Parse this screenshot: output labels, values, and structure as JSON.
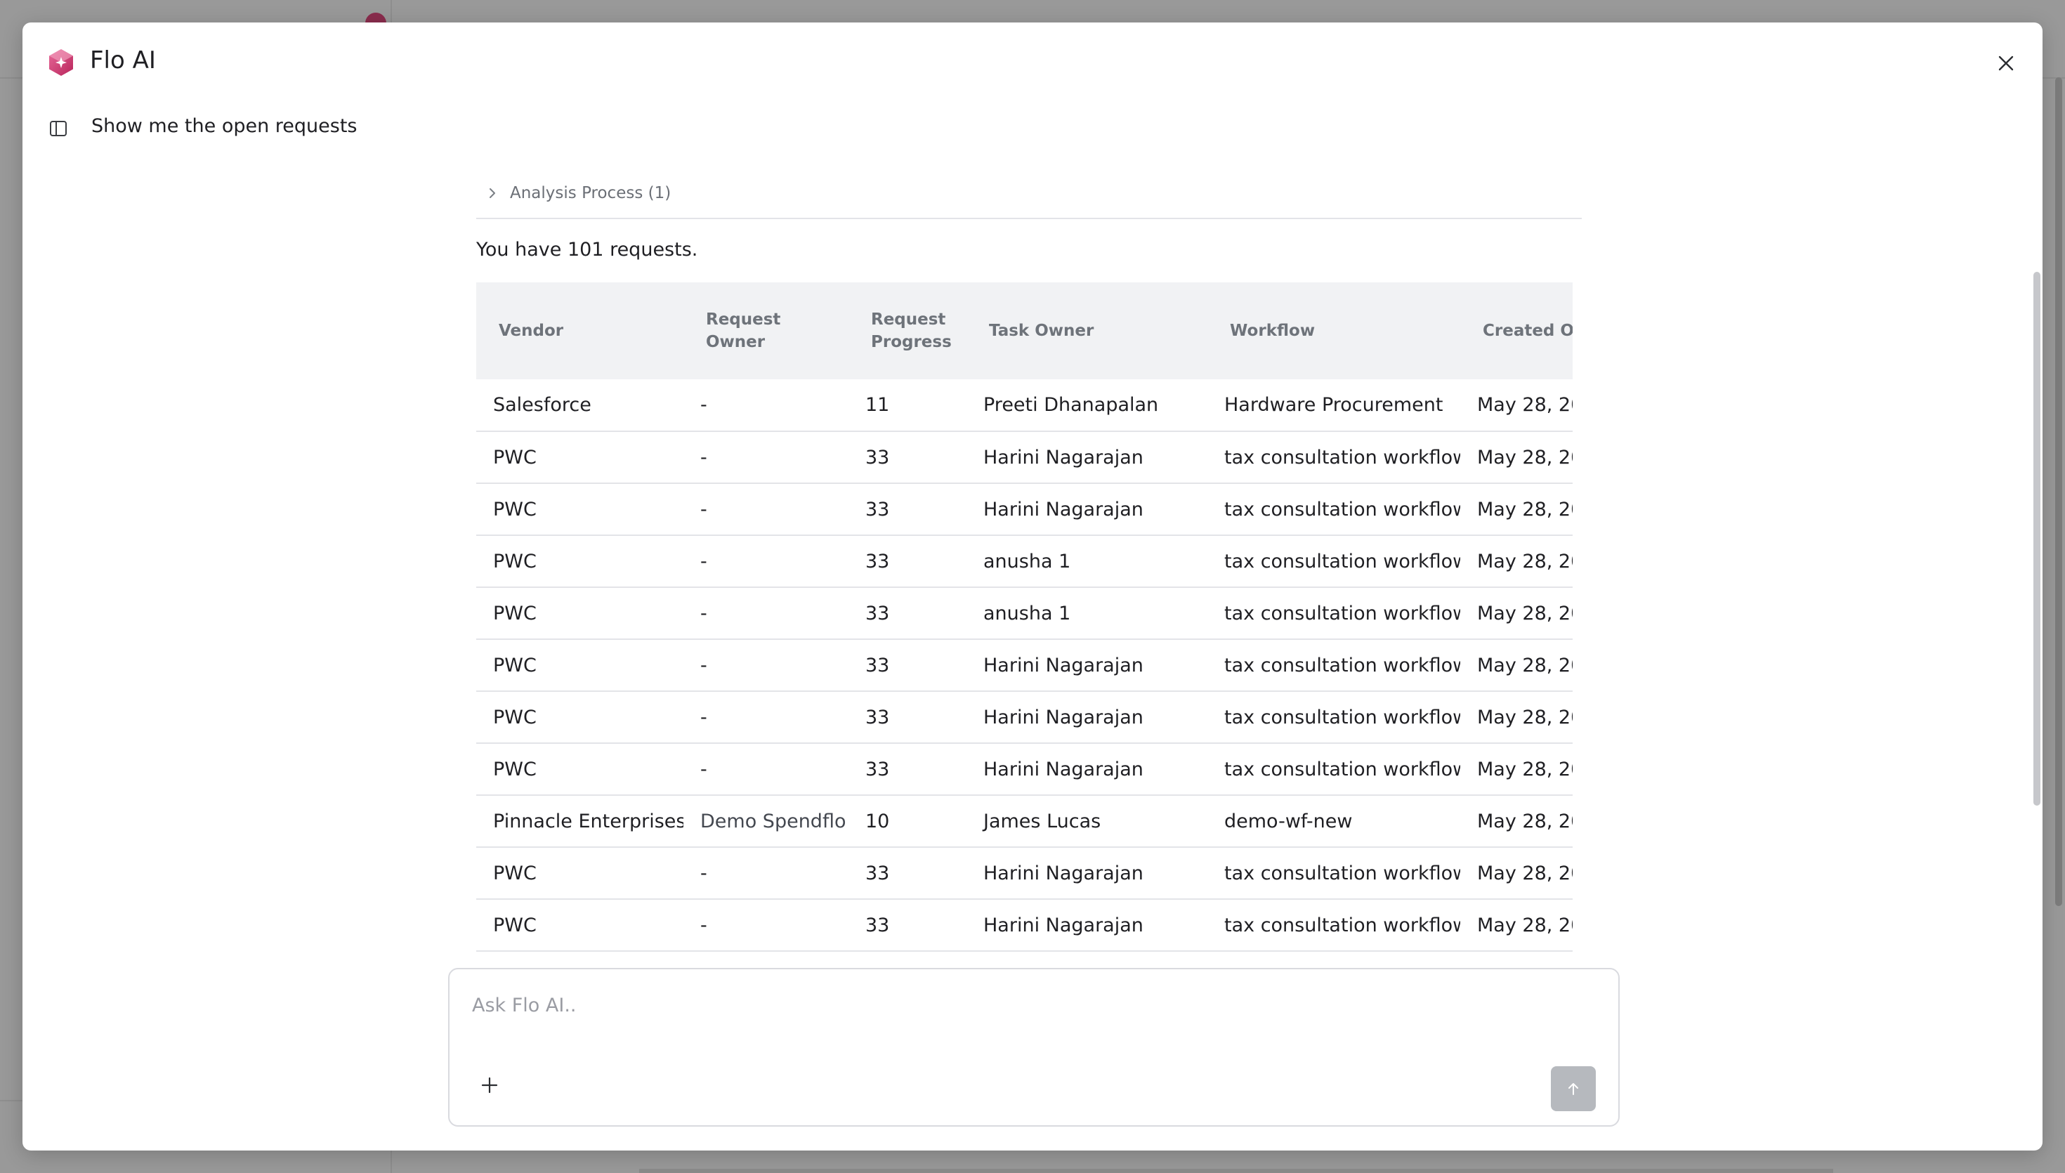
{
  "app": {
    "title": "Flo AI",
    "accent": "#d6467a"
  },
  "conversation": {
    "title": "Show me the open requests"
  },
  "analysis": {
    "label": "Analysis Process (1)"
  },
  "summary": "You have 101 requests.",
  "table": {
    "columns": [
      "Vendor",
      "Request Owner",
      "Request Progress",
      "Task Owner",
      "Workflow",
      "Created On"
    ],
    "rows": [
      [
        "Salesforce",
        "-",
        "11",
        "Preeti Dhanapalan",
        "Hardware Procurement",
        "May 28, 20"
      ],
      [
        "PWC",
        "-",
        "33",
        "Harini Nagarajan",
        "tax consultation workflow",
        "May 28, 20"
      ],
      [
        "PWC",
        "-",
        "33",
        "Harini Nagarajan",
        "tax consultation workflow",
        "May 28, 20"
      ],
      [
        "PWC",
        "-",
        "33",
        "anusha 1",
        "tax consultation workflow",
        "May 28, 20"
      ],
      [
        "PWC",
        "-",
        "33",
        "anusha 1",
        "tax consultation workflow",
        "May 28, 20"
      ],
      [
        "PWC",
        "-",
        "33",
        "Harini Nagarajan",
        "tax consultation workflow",
        "May 28, 20"
      ],
      [
        "PWC",
        "-",
        "33",
        "Harini Nagarajan",
        "tax consultation workflow",
        "May 28, 20"
      ],
      [
        "PWC",
        "-",
        "33",
        "Harini Nagarajan",
        "tax consultation workflow",
        "May 28, 20"
      ],
      [
        "Pinnacle Enterprises",
        "Demo Spendflo",
        "10",
        "James Lucas",
        "demo-wf-new",
        "May 28, 20"
      ],
      [
        "PWC",
        "-",
        "33",
        "Harini Nagarajan",
        "tax consultation workflow",
        "May 28, 20"
      ],
      [
        "PWC",
        "-",
        "33",
        "Harini Nagarajan",
        "tax consultation workflow",
        "May 28, 20"
      ]
    ]
  },
  "composer": {
    "placeholder": "Ask Flo AI..",
    "value": ""
  },
  "icons": {
    "logo": "flo-ai-logo-icon",
    "close": "close-icon",
    "sidebar": "sidebar-toggle-icon",
    "chevron": "chevron-right-icon",
    "add": "plus-icon",
    "send": "arrow-up-icon"
  }
}
